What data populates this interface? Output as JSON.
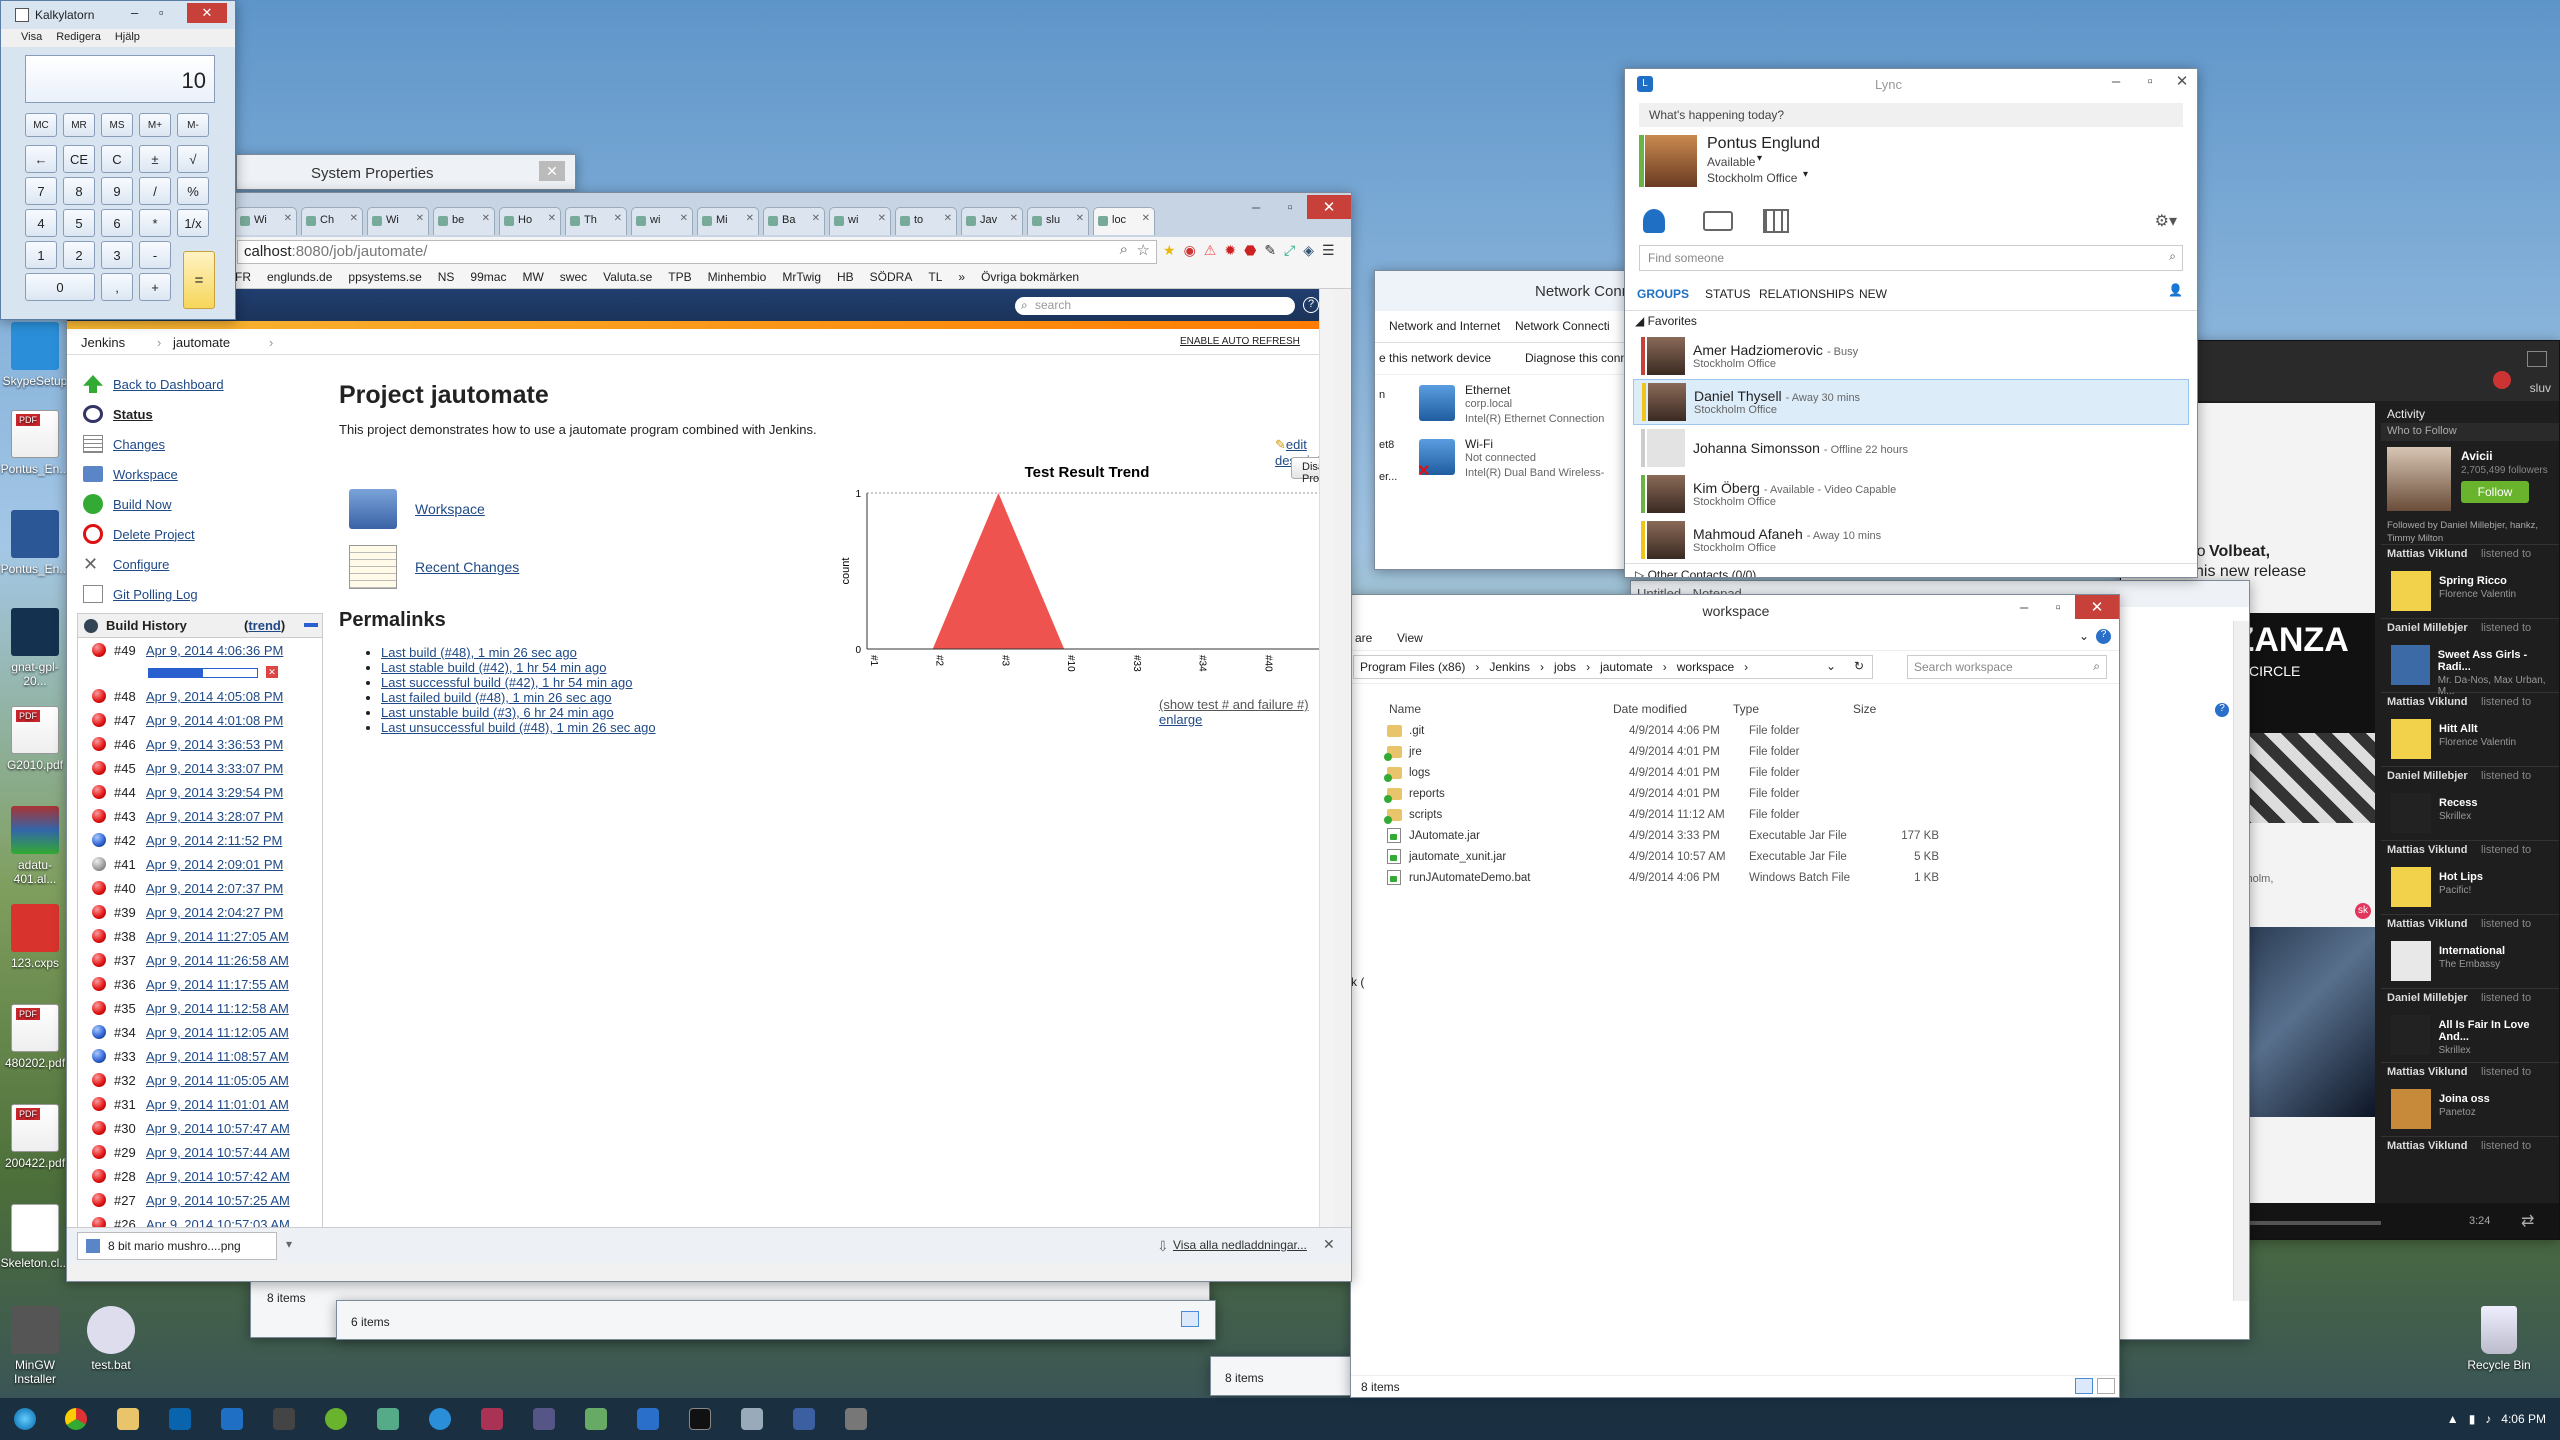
{
  "calculator": {
    "title": "Kalkylatorn",
    "menu": [
      "Visa",
      "Redigera",
      "Hjälp"
    ],
    "display": "10",
    "keys": [
      [
        "MC",
        "MR",
        "MS",
        "M+",
        "M-"
      ],
      [
        "←",
        "CE",
        "C",
        "±",
        "√"
      ],
      [
        "7",
        "8",
        "9",
        "/",
        "%"
      ],
      [
        "4",
        "5",
        "6",
        "*",
        "1/x"
      ],
      [
        "1",
        "2",
        "3",
        "-",
        ""
      ],
      [
        "0",
        "",
        ",",
        "+",
        "="
      ]
    ]
  },
  "system_properties": {
    "title": "System Properties"
  },
  "desktop_icons": [
    "SkypeSetup",
    "Pontus_En...",
    "Pontus_En...",
    "gnat-gpl-20...",
    "G2010.pdf",
    "adatu-401.al...",
    "123.cxps",
    "480202.pdf",
    "200422.pdf",
    "Skeleton.cl...",
    "MinGW Installer",
    "test.bat",
    "Recycle Bin"
  ],
  "chrome": {
    "tabs": [
      "Wi",
      "Ch",
      "Wi",
      "be",
      "Ho",
      "Th",
      "wi",
      "Mi",
      "Ba",
      "wi",
      "to",
      "Jav",
      "slu",
      "loc"
    ],
    "url_host": "calhost",
    "url_rest": ":8080/job/jautomate/",
    "bookmarks": [
      "FR",
      "englunds.de",
      "ppsystems.se",
      "NS",
      "99mac",
      "MW",
      "swec",
      "Valuta.se",
      "TPB",
      "Minhembio",
      "MrTwig",
      "HB",
      "SÖDRA",
      "TL",
      "»",
      "Övriga bokmärken"
    ],
    "download_file": "8 bit mario mushro....png",
    "download_all": "Visa alla nedladdningar..."
  },
  "jenkins": {
    "search_placeholder": "search",
    "breadcrumb": [
      "Jenkins",
      "jautomate"
    ],
    "auto_refresh": "ENABLE AUTO REFRESH",
    "side": [
      "Back to Dashboard",
      "Status",
      "Changes",
      "Workspace",
      "Build Now",
      "Delete Project",
      "Configure",
      "Git Polling Log"
    ],
    "title": "Project jautomate",
    "description": "This project demonstrates how to use a jautomate program combined with Jenkins.",
    "edit_description": "edit description",
    "disable_project": "Disable Project",
    "workspace_link": "Workspace",
    "recent_changes_link": "Recent Changes",
    "permalinks_title": "Permalinks",
    "permalinks": [
      "Last build (#48), 1 min 26 sec ago",
      "Last stable build (#42), 1 hr 54 min ago",
      "Last successful build (#42), 1 hr 54 min ago",
      "Last failed build (#48), 1 min 26 sec ago",
      "Last unstable build (#3), 6 hr 24 min ago",
      "Last unsuccessful build (#48), 1 min 26 sec ago"
    ],
    "build_history_title": "Build History",
    "trend": "trend",
    "builds": [
      {
        "n": "#49",
        "d": "Apr 9, 2014 4:06:36 PM",
        "s": "red"
      },
      {
        "n": "#48",
        "d": "Apr 9, 2014 4:05:08 PM",
        "s": "red"
      },
      {
        "n": "#47",
        "d": "Apr 9, 2014 4:01:08 PM",
        "s": "red"
      },
      {
        "n": "#46",
        "d": "Apr 9, 2014 3:36:53 PM",
        "s": "red"
      },
      {
        "n": "#45",
        "d": "Apr 9, 2014 3:33:07 PM",
        "s": "red"
      },
      {
        "n": "#44",
        "d": "Apr 9, 2014 3:29:54 PM",
        "s": "red"
      },
      {
        "n": "#43",
        "d": "Apr 9, 2014 3:28:07 PM",
        "s": "red"
      },
      {
        "n": "#42",
        "d": "Apr 9, 2014 2:11:52 PM",
        "s": "blue"
      },
      {
        "n": "#41",
        "d": "Apr 9, 2014 2:09:01 PM",
        "s": "grey"
      },
      {
        "n": "#40",
        "d": "Apr 9, 2014 2:07:37 PM",
        "s": "red"
      },
      {
        "n": "#39",
        "d": "Apr 9, 2014 2:04:27 PM",
        "s": "red"
      },
      {
        "n": "#38",
        "d": "Apr 9, 2014 11:27:05 AM",
        "s": "red"
      },
      {
        "n": "#37",
        "d": "Apr 9, 2014 11:26:58 AM",
        "s": "red"
      },
      {
        "n": "#36",
        "d": "Apr 9, 2014 11:17:55 AM",
        "s": "red"
      },
      {
        "n": "#35",
        "d": "Apr 9, 2014 11:12:58 AM",
        "s": "red"
      },
      {
        "n": "#34",
        "d": "Apr 9, 2014 11:12:05 AM",
        "s": "blue"
      },
      {
        "n": "#33",
        "d": "Apr 9, 2014 11:08:57 AM",
        "s": "blue"
      },
      {
        "n": "#32",
        "d": "Apr 9, 2014 11:05:05 AM",
        "s": "red"
      },
      {
        "n": "#31",
        "d": "Apr 9, 2014 11:01:01 AM",
        "s": "red"
      },
      {
        "n": "#30",
        "d": "Apr 9, 2014 10:57:47 AM",
        "s": "red"
      },
      {
        "n": "#29",
        "d": "Apr 9, 2014 10:57:44 AM",
        "s": "red"
      },
      {
        "n": "#28",
        "d": "Apr 9, 2014 10:57:42 AM",
        "s": "red"
      },
      {
        "n": "#27",
        "d": "Apr 9, 2014 10:57:25 AM",
        "s": "red"
      },
      {
        "n": "#26",
        "d": "Apr 9, 2014 10:57:03 AM",
        "s": "red"
      }
    ],
    "show_test": "(show test # and failure #)",
    "enlarge": "enlarge"
  },
  "chart_data": {
    "type": "area",
    "title": "Test Result Trend",
    "ylabel": "count",
    "categories": [
      "#1",
      "#2",
      "#3",
      "#10",
      "#33",
      "#34",
      "#40",
      "#42"
    ],
    "values": [
      0,
      0,
      1,
      0,
      0,
      0,
      0,
      0
    ],
    "ylim": [
      0,
      1
    ],
    "yticks": [
      "0",
      "1"
    ],
    "color": "#ef5350"
  },
  "network": {
    "title": "Network Conn",
    "crumb": [
      "Network and Internet",
      "Network Connecti"
    ],
    "actions": [
      "e this network device",
      "Diagnose this conn"
    ],
    "items": [
      {
        "name": "Ethernet",
        "l2": "corp.local",
        "l3": "Intel(R) Ethernet Connection"
      },
      {
        "name": "Wi-Fi",
        "l2": "Not connected",
        "l3": "Intel(R) Dual Band Wireless-"
      }
    ],
    "partial": [
      "n",
      "et8",
      "er..."
    ]
  },
  "lync": {
    "title": "Lync",
    "whats_happening": "What's happening today?",
    "name": "Pontus Englund",
    "status": "Available",
    "location": "Stockholm Office",
    "find_placeholder": "Find someone",
    "tabs": [
      "GROUPS",
      "STATUS",
      "RELATIONSHIPS",
      "NEW"
    ],
    "favorites": "Favorites",
    "other_contacts": "Other Contacts (0/0)",
    "contacts": [
      {
        "name": "Amer Hadziomerovic",
        "status": "- Busy",
        "loc": "Stockholm Office",
        "color": "#c7403a"
      },
      {
        "name": "Daniel Thysell",
        "status": "- Away 30 mins",
        "loc": "Stockholm Office",
        "color": "#f0c419"
      },
      {
        "name": "Johanna Simonsson",
        "status": "- Offline 22 hours",
        "loc": "",
        "color": "#ccc"
      },
      {
        "name": "Kim Öberg",
        "status": "- Available - Video Capable",
        "loc": "Stockholm Office",
        "color": "#6ab446"
      },
      {
        "name": "Mahmoud Afaneh",
        "status": "- Away 10 mins",
        "loc": "Stockholm Office",
        "color": "#f0c419"
      }
    ]
  },
  "notepad": {
    "title": "Untitled - Notepad"
  },
  "explorer": {
    "title": "workspace",
    "ribbon": [
      "are",
      "View"
    ],
    "path": [
      "Program Files (x86)",
      "Jenkins",
      "jobs",
      "jautomate",
      "workspace"
    ],
    "search_placeholder": "Search workspace",
    "columns": [
      "Name",
      "Date modified",
      "Type",
      "Size"
    ],
    "files": [
      {
        "name": ".git",
        "date": "4/9/2014 4:06 PM",
        "type": "File folder",
        "size": "",
        "kind": "folder"
      },
      {
        "name": "jre",
        "date": "4/9/2014 4:01 PM",
        "type": "File folder",
        "size": "",
        "kind": "folder"
      },
      {
        "name": "logs",
        "date": "4/9/2014 4:01 PM",
        "type": "File folder",
        "size": "",
        "kind": "folder"
      },
      {
        "name": "reports",
        "date": "4/9/2014 4:01 PM",
        "type": "File folder",
        "size": "",
        "kind": "folder"
      },
      {
        "name": "scripts",
        "date": "4/9/2014 11:12 AM",
        "type": "File folder",
        "size": "",
        "kind": "folder"
      },
      {
        "name": "JAutomate.jar",
        "date": "4/9/2014 3:33 PM",
        "type": "Executable Jar File",
        "size": "177 KB",
        "kind": "file"
      },
      {
        "name": "jautomate_xunit.jar",
        "date": "4/9/2014 10:57 AM",
        "type": "Executable Jar File",
        "size": "5 KB",
        "kind": "file"
      },
      {
        "name": "runJAutomateDemo.bat",
        "date": "4/9/2014 4:06 PM",
        "type": "Windows Batch File",
        "size": "1 KB",
        "kind": "file"
      }
    ],
    "status": "8 items",
    "partial": "k ("
  },
  "bg_windows": {
    "items_8": "8 items",
    "items_6": "6 items",
    "items_8b": "8 items",
    "stockholm": "kholm,"
  },
  "spotify": {
    "user": "sluv",
    "activity": "Activity",
    "who_to_follow": "Who to Follow",
    "artist": "Avicii",
    "followers": "2,705,499 followers",
    "follow": "Follow",
    "followed_by": "Followed by Daniel Millebjer, hankz, Timmy Milton",
    "snippet1": "ned to",
    "snippet1b": "Volbeat,",
    "snippet2": "his new release",
    "banner": "RZANZA",
    "banner2": "CIRCLE",
    "time": "3:24",
    "feed": [
      {
        "user": "Mattias Viklund",
        "action": "listened to",
        "track": "Spring Ricco",
        "artist": "Florence Valentin"
      },
      {
        "user": "Daniel Millebjer",
        "action": "listened to",
        "track": "Sweet Ass Girls - Radi...",
        "artist": "Mr. Da-Nos, Max Urban, M..."
      },
      {
        "user": "Mattias Viklund",
        "action": "listened to",
        "track": "Hitt Allt",
        "artist": "Florence Valentin"
      },
      {
        "user": "Daniel Millebjer",
        "action": "listened to",
        "track": "Recess",
        "artist": "Skrillex"
      },
      {
        "user": "Mattias Viklund",
        "action": "listened to",
        "track": "Hot Lips",
        "artist": "Pacific!"
      },
      {
        "user": "Mattias Viklund",
        "action": "listened to",
        "track": "International",
        "artist": "The Embassy"
      },
      {
        "user": "Daniel Millebjer",
        "action": "listened to",
        "track": "All Is Fair In Love And...",
        "artist": "Skrillex"
      },
      {
        "user": "Mattias Viklund",
        "action": "listened to",
        "track": "Joina oss",
        "artist": "Panetoz"
      },
      {
        "user": "Mattias Viklund",
        "action": "listened to",
        "track": "",
        "artist": ""
      }
    ]
  },
  "taskbar": {
    "clock": "4:06 PM"
  }
}
